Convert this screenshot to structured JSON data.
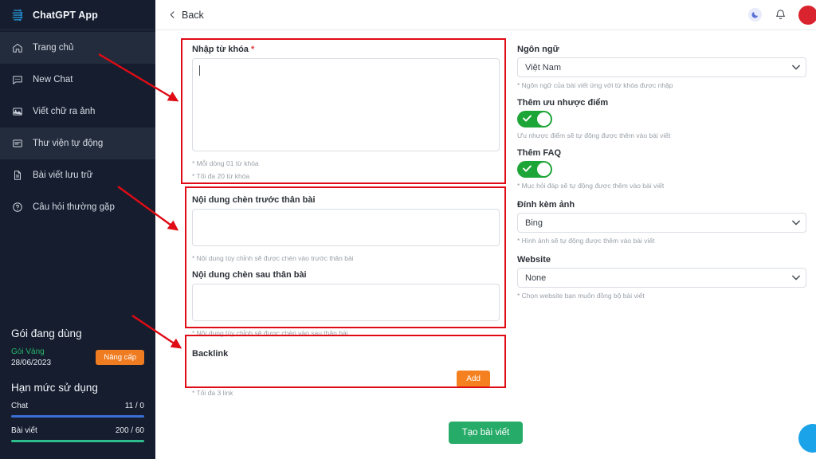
{
  "sidebar": {
    "brand": {
      "title": "ChatGPT App",
      "logo_icon": "network-brain-icon"
    },
    "items": [
      {
        "label": "Trang chủ",
        "icon": "home-icon",
        "active": true
      },
      {
        "label": "New Chat",
        "icon": "chat-bubble-icon",
        "active": false
      },
      {
        "label": "Viết chữ ra ảnh",
        "icon": "image-icon",
        "active": false
      },
      {
        "label": "Thư viện tự động",
        "icon": "document-lines-icon",
        "active": true
      },
      {
        "label": "Bài viết lưu trữ",
        "icon": "file-icon",
        "active": false
      },
      {
        "label": "Câu hỏi thường gặp",
        "icon": "question-circle-icon",
        "active": false
      }
    ],
    "plan": {
      "heading": "Gói đang dùng",
      "name": "Gói Vàng",
      "date": "28/06/2023",
      "upgrade_label": "Nâng cấp",
      "name_color": "#29b56b",
      "upgrade_color": "#f07c21"
    },
    "usage": {
      "heading": "Hạn mức sử dụng",
      "items": [
        {
          "label": "Chat",
          "value": "11 / 0",
          "color": "#3a6fd8",
          "percent": 100
        },
        {
          "label": "Bài viết",
          "value": "200 / 60",
          "color": "#2dbd8c",
          "percent": 100
        }
      ]
    }
  },
  "topbar": {
    "back_label": "Back",
    "back_icon": "chevron-left-icon",
    "dark_mode_icon": "moon-icon",
    "notification_icon": "bell-icon",
    "avatar_icon": "avatar"
  },
  "form": {
    "keyword": {
      "label": "Nhập từ khóa",
      "required_mark": "*",
      "value": "",
      "hint1": "* Mỗi dòng 01 từ khóa",
      "hint2": "* Tối đa 20 từ khóa"
    },
    "before_body": {
      "label": "Nội dung chèn trước thân bài",
      "value": "",
      "hint": "* Nội dung tùy chỉnh sẽ được chèn vào trước thân bài"
    },
    "after_body": {
      "label": "Nội dung chèn sau thân bài",
      "value": "",
      "hint": "* Nội dung tùy chỉnh sẽ được chèn vào sau thân bài"
    },
    "backlink": {
      "label": "Backlink",
      "add_label": "Add",
      "hint": "* Tối đa 3 link"
    },
    "language": {
      "label": "Ngôn ngữ",
      "value": "Việt Nam",
      "hint": "* Ngôn ngữ của bài viết ứng với từ khóa được nhập"
    },
    "pros_cons": {
      "label": "Thêm ưu nhược điểm",
      "enabled": true,
      "hint": "Ưu nhược điểm sẽ tự động được thêm vào bài viết"
    },
    "faq": {
      "label": "Thêm FAQ",
      "enabled": true,
      "hint": "* Mục hỏi đáp sẽ tự động được thêm vào bài viết"
    },
    "image_source": {
      "label": "Đính kèm ảnh",
      "value": "Bing",
      "hint": "* Hình ảnh sẽ tự động được thêm vào bài viết"
    },
    "website": {
      "label": "Website",
      "value": "None",
      "hint": "* Chọn website bạn muốn đồng bộ bài viết"
    },
    "submit_label": "Tạo bài viết",
    "submit_color": "#27ab69"
  },
  "annotations": {
    "highlight_color": "#e00b15",
    "boxes": 4,
    "arrows": 4
  }
}
